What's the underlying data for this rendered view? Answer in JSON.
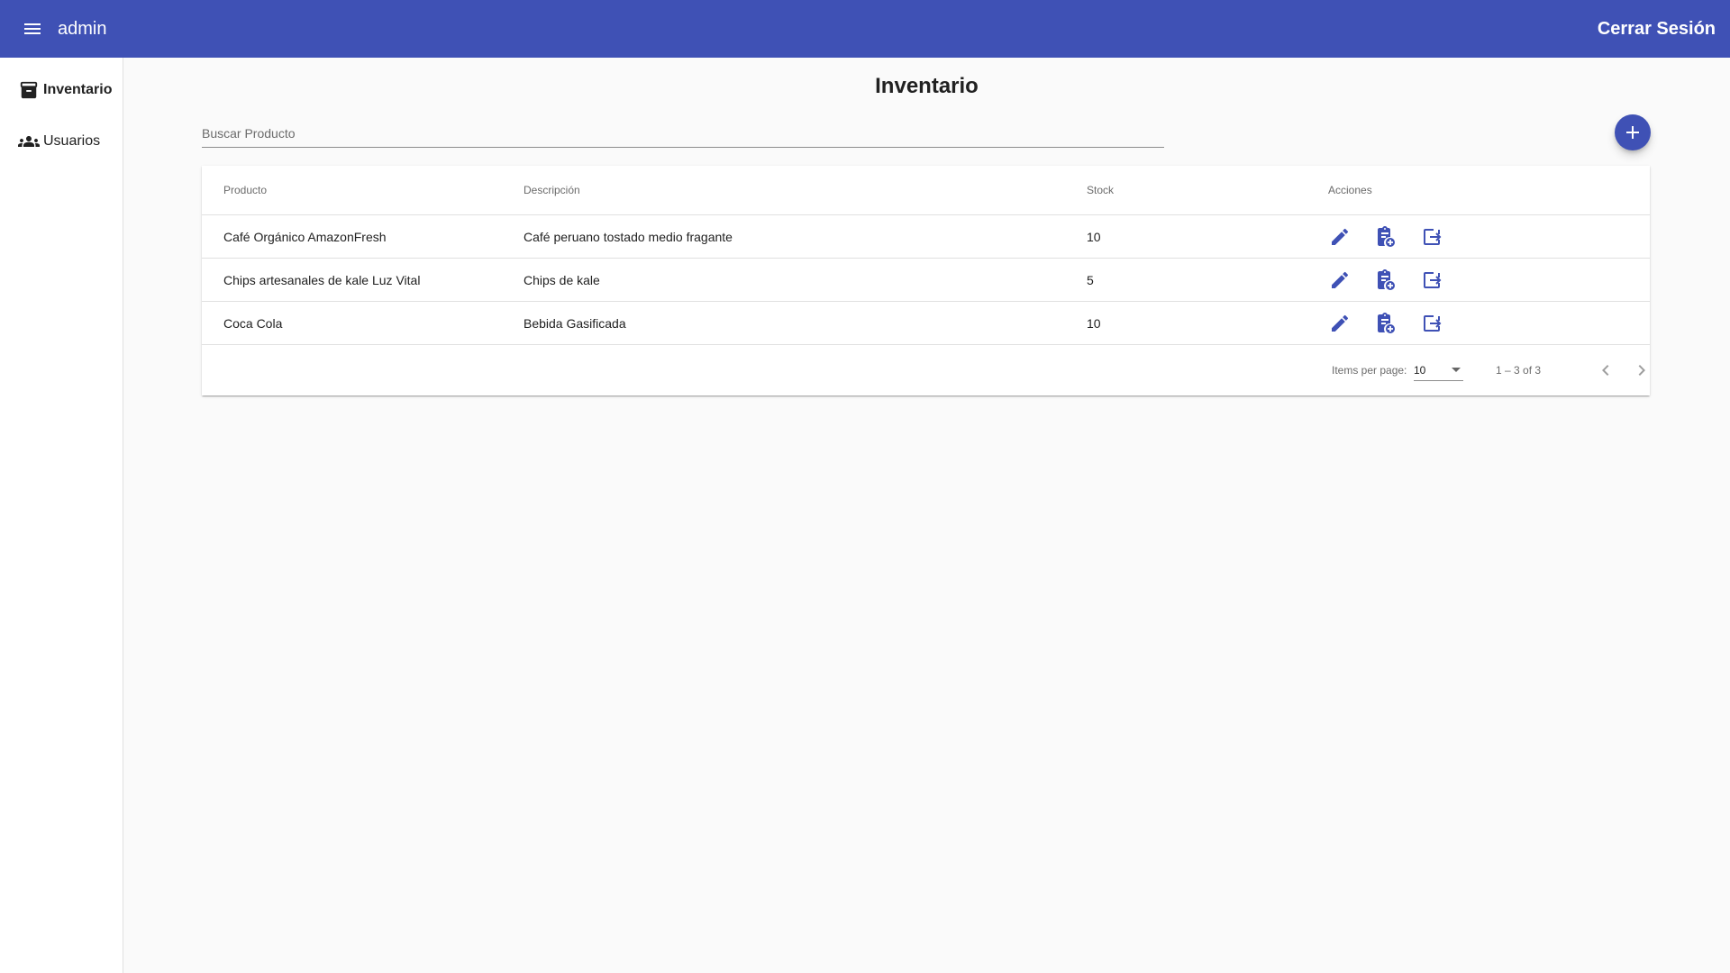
{
  "toolbar": {
    "title": "admin",
    "logout_label": "Cerrar Sesión"
  },
  "sidenav": {
    "items": [
      {
        "label": "Inventario",
        "icon": "archive-icon",
        "active": true
      },
      {
        "label": "Usuarios",
        "icon": "group-icon",
        "active": false
      }
    ]
  },
  "page": {
    "title": "Inventario"
  },
  "search": {
    "placeholder": "Buscar Producto",
    "value": ""
  },
  "table": {
    "headers": [
      "Producto",
      "Descripción",
      "Stock",
      "Acciones"
    ],
    "rows": [
      {
        "producto": "Café Orgánico AmazonFresh",
        "descripcion": "Café peruano tostado medio fragante",
        "stock": "10"
      },
      {
        "producto": "Chips artesanales de kale Luz Vital",
        "descripcion": "Chips de kale",
        "stock": "5"
      },
      {
        "producto": "Coca Cola",
        "descripcion": "Bebida Gasificada",
        "stock": "10"
      }
    ],
    "actions": [
      "edit-icon",
      "clipboard-add-icon",
      "exit-to-app-icon"
    ]
  },
  "paginator": {
    "items_label": "Items per page:",
    "page_size": "10",
    "range": "1 – 3 of 3"
  },
  "colors": {
    "primary": "#3f51b5",
    "background": "#fafafa"
  }
}
